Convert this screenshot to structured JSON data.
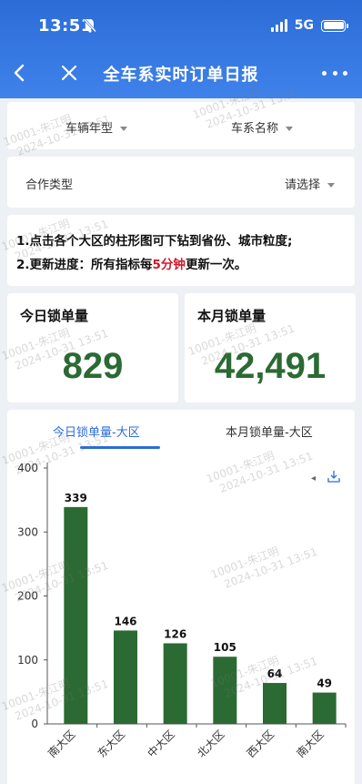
{
  "status_bar": {
    "time": "13:51",
    "network": "5G"
  },
  "nav": {
    "title": "全车系实时订单日报"
  },
  "filters": {
    "model_year_label": "车辆年型",
    "series_name_label": "车系名称",
    "cooperation_label": "合作类型",
    "cooperation_placeholder": "请选择"
  },
  "notes": {
    "line1_num": "1.",
    "line1_text": "点击各个大区的柱形图可下钻到省份、城市粒度;",
    "line2_num": "2.",
    "line2_prefix": "更新进度：所有指标每",
    "line2_highlight": "5分钟",
    "line2_suffix": "更新一次。"
  },
  "kpis": {
    "today": {
      "label": "今日锁单量",
      "value": "829"
    },
    "month": {
      "label": "本月锁单量",
      "value": "42,491"
    }
  },
  "tabs": {
    "today_region": "今日锁单量-大区",
    "month_region": "本月锁单量-大区"
  },
  "watermark": {
    "user": "10001-朱江明",
    "date": "2024-10-31 13:51"
  },
  "colors": {
    "accent": "#2c6cd8",
    "bar": "#2b6a33",
    "kpi_value": "#2b6a33",
    "highlight": "#d0182b"
  },
  "chart_data": {
    "type": "bar",
    "categories": [
      "南大区",
      "东大区",
      "中大区",
      "北大区",
      "西大区",
      "南大区"
    ],
    "values": [
      339,
      146,
      126,
      105,
      64,
      49
    ],
    "yticks": [
      "0",
      "100",
      "200",
      "300",
      "400"
    ],
    "ylim": [
      0,
      400
    ],
    "grid": false
  }
}
